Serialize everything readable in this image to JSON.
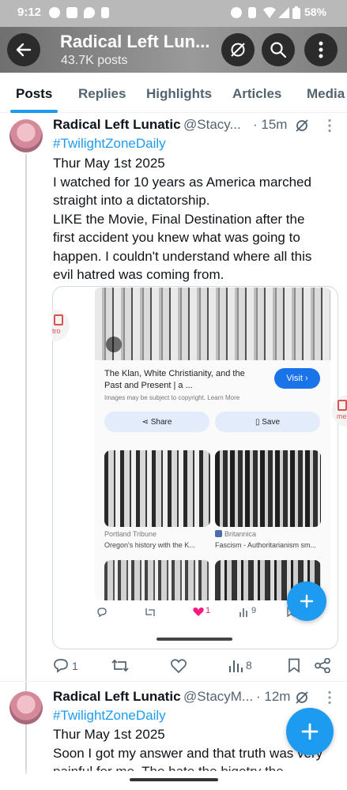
{
  "status_bar": {
    "time": "9:12",
    "battery": "58%"
  },
  "header": {
    "title": "Radical Left Lun...",
    "subtitle": "43.7K posts"
  },
  "tabs": [
    "Posts",
    "Replies",
    "Highlights",
    "Articles",
    "Media"
  ],
  "tweet1": {
    "name": "Radical Left Lunatic",
    "handle": "@Stacy...",
    "time": "· 15m",
    "hashtag": "#TwilightZoneDaily",
    "lines": [
      " Thur May 1st  2025",
      "I watched for 10 years as America marched",
      "straight into a dictatorship.",
      " LIKE the Movie, Final Destination after the",
      "first accident you knew what was going to",
      "happen. I couldn't understand where all this",
      "evil hatred was coming from."
    ],
    "embed": {
      "result_title_1": "The Klan, White Christianity, and the",
      "result_title_2": "Past and Present | a ...",
      "copyright": "Images may be subject to copyright. Learn More",
      "visit_label": "Visit",
      "share_label": "Share",
      "save_label": "Save",
      "thumb1_source": "Portland Tribune",
      "thumb1_title": "Oregon's history with the K...",
      "thumb2_source": "Britannica",
      "thumb2_title": "Fascism - Authoritarianism sm...",
      "inner_like_count": "1",
      "inner_view_count": "9",
      "left_partial": "tro",
      "right_partial": "me"
    },
    "actions": {
      "replies": "1",
      "views": "8"
    }
  },
  "tweet2": {
    "name": "Radical Left Lunatic",
    "handle": "@StacyM...",
    "time": "· 12m",
    "hashtag": "#TwilightZoneDaily",
    "lines": [
      "Thur May 1st 2025",
      "Soon I got my answer and that truth was very",
      "painful for me. The hate the bigotry the"
    ]
  },
  "colors": {
    "accent": "#1d9bf0",
    "like": "#f91880",
    "muted": "#536471"
  }
}
